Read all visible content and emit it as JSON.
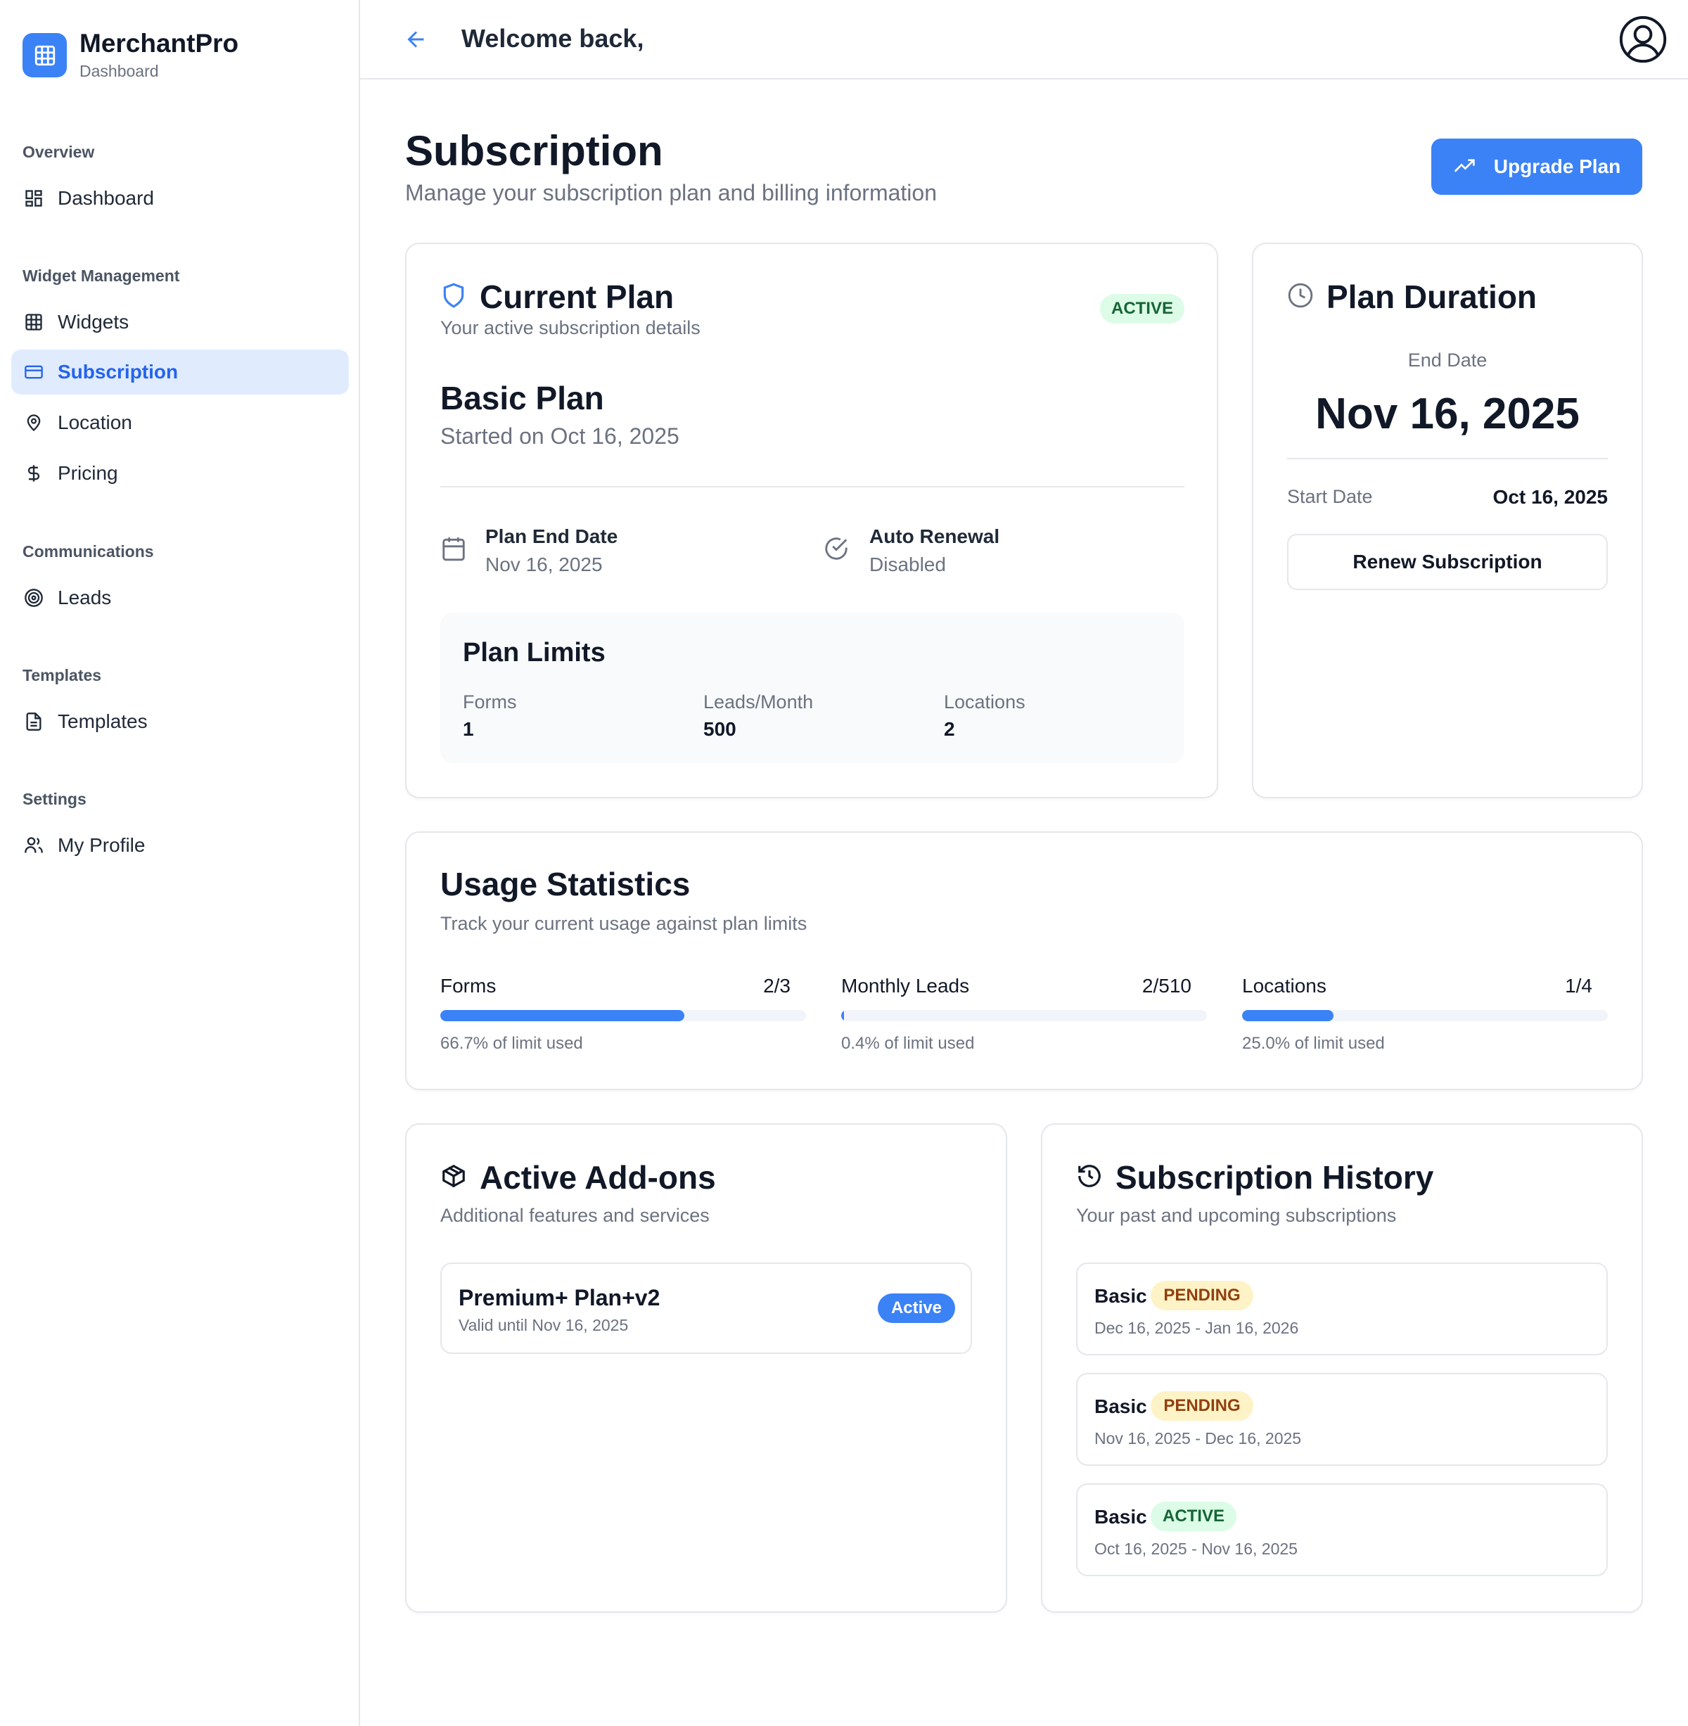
{
  "brand": {
    "name": "MerchantPro",
    "subtitle": "Dashboard",
    "accent": "#3b82f6"
  },
  "sidebar": {
    "sections": [
      {
        "title": "Overview"
      },
      {
        "title": "Widget Management"
      },
      {
        "title": "Communications"
      },
      {
        "title": "Templates"
      },
      {
        "title": "Settings"
      }
    ],
    "items": [
      {
        "label": "Dashboard",
        "icon": "layout-dashboard-icon"
      },
      {
        "label": "Widgets",
        "icon": "grid-icon"
      },
      {
        "label": "Subscription",
        "icon": "credit-card-icon",
        "active": true
      },
      {
        "label": "Location",
        "icon": "map-pin-icon"
      },
      {
        "label": "Pricing",
        "icon": "dollar-sign-icon"
      },
      {
        "label": "Leads",
        "icon": "target-icon"
      },
      {
        "label": "Templates",
        "icon": "file-text-icon"
      },
      {
        "label": "My Profile",
        "icon": "users-icon"
      }
    ]
  },
  "header": {
    "welcome": "Welcome back,"
  },
  "page": {
    "title": "Subscription",
    "subtitle": "Manage your subscription plan and billing information",
    "upgrade_label": "Upgrade Plan"
  },
  "current_plan": {
    "title": "Current Plan",
    "subtitle": "Your active subscription details",
    "status": "ACTIVE",
    "plan_name": "Basic Plan",
    "started": "Started on Oct 16, 2025",
    "end_label": "Plan End Date",
    "end_value": "Nov 16, 2025",
    "renewal_label": "Auto Renewal",
    "renewal_value": "Disabled",
    "limits_title": "Plan Limits",
    "limits": [
      {
        "label": "Forms",
        "value": "1"
      },
      {
        "label": "Leads/Month",
        "value": "500"
      },
      {
        "label": "Locations",
        "value": "2"
      }
    ]
  },
  "plan_duration": {
    "title": "Plan Duration",
    "end_label": "End Date",
    "end_value": "Nov 16, 2025",
    "start_label": "Start Date",
    "start_value": "Oct 16, 2025",
    "renew_label": "Renew Subscription"
  },
  "usage": {
    "title": "Usage Statistics",
    "subtitle": "Track your current usage against plan limits",
    "items": [
      {
        "label": "Forms",
        "count": "2/3",
        "percent": 66.7,
        "caption": "66.7% of limit used"
      },
      {
        "label": "Monthly Leads",
        "count": "2/510",
        "percent": 0.4,
        "caption": "0.4% of limit used"
      },
      {
        "label": "Locations",
        "count": "1/4",
        "percent": 25.0,
        "caption": "25.0% of limit used"
      }
    ]
  },
  "addons": {
    "title": "Active Add-ons",
    "subtitle": "Additional features and services",
    "items": [
      {
        "name": "Premium+ Plan+v2",
        "valid": "Valid until Nov 16, 2025",
        "status": "Active"
      }
    ]
  },
  "history": {
    "title": "Subscription History",
    "subtitle": "Your past and upcoming subscriptions",
    "items": [
      {
        "plan": "Basic",
        "status": "PENDING",
        "dates": "Dec 16, 2025 - Jan 16, 2026"
      },
      {
        "plan": "Basic",
        "status": "PENDING",
        "dates": "Nov 16, 2025 - Dec 16, 2025"
      },
      {
        "plan": "Basic",
        "status": "ACTIVE",
        "dates": "Oct 16, 2025 - Nov 16, 2025"
      }
    ]
  }
}
